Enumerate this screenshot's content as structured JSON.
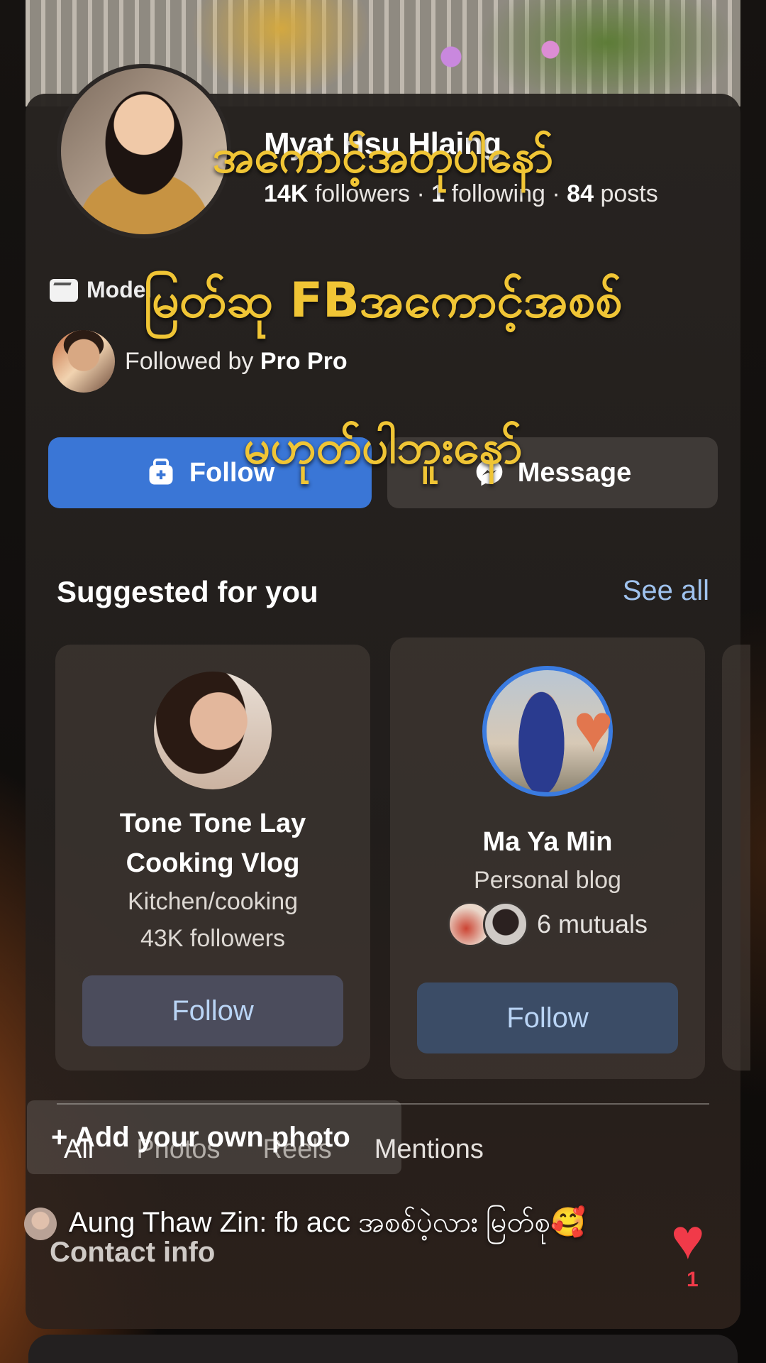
{
  "profile": {
    "name": "Myat Hsu Hlaing",
    "followers": "14K",
    "followers_label": "followers",
    "following": "1",
    "following_label": "following",
    "posts": "84",
    "posts_label": "posts",
    "category": "Model",
    "followed_by_prefix": "Followed by",
    "followed_by_name": "Pro Pro"
  },
  "actions": {
    "follow_label": "Follow",
    "message_label": "Message"
  },
  "suggested": {
    "heading": "Suggested for you",
    "see_all": "See all",
    "cards": [
      {
        "name_line1": "Tone Tone Lay",
        "name_line2": "Cooking Vlog",
        "category": "Kitchen/cooking",
        "followers": "43K followers",
        "button": "Follow"
      },
      {
        "name": "Ma Ya Min",
        "category": "Personal blog",
        "mutuals": "6 mutuals",
        "button": "Follow"
      }
    ]
  },
  "tabs": [
    "All",
    "Photos",
    "Reels",
    "Mentions"
  ],
  "add_photo": "+ Add your own photo",
  "contact_info": "Contact info",
  "comment": {
    "author": "Aung Thaw Zin:",
    "text": "fb acc အစစ်ပဲ့လား မြတ်စု🥰"
  },
  "likes": {
    "count": "1"
  },
  "captions": {
    "line1": "အကောင့်အတုပါနော်",
    "line2": "မြတ်ဆု FBအကောင့်အစစ်",
    "line3": "မဟုတ်ပါဘူးနော်"
  },
  "colors": {
    "primary_button": "#3a76d6",
    "link": "#9fc2ee",
    "caption": "#f0c535",
    "like": "#f13a49"
  }
}
